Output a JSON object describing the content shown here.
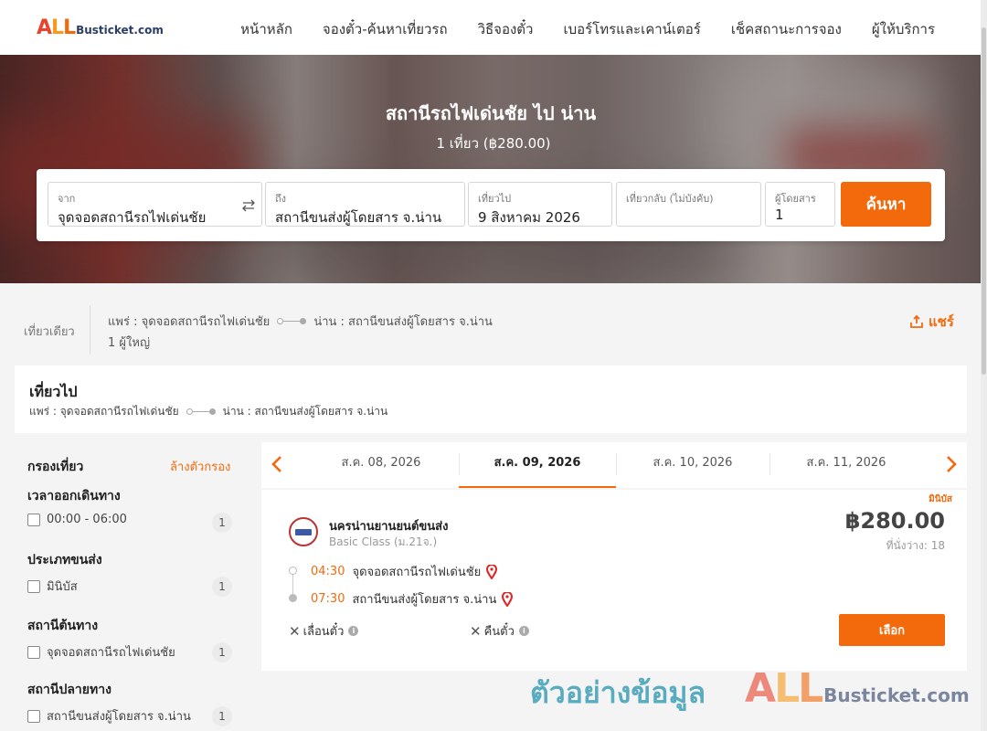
{
  "logo": {
    "all": "ALL",
    "rest": "Busticket.com",
    "colors": {
      "a": "#e8432c",
      "l1": "#f49a1c",
      "l2": "#f26a0c"
    }
  },
  "nav": [
    "หน้าหลัก",
    "จองตั๋ว-ค้นหาเที่ยวรถ",
    "วิธีจองตั๋ว",
    "เบอร์โทรและเคาน์เตอร์",
    "เช็คสถานะการจอง",
    "ผู้ให้บริการ"
  ],
  "hero": {
    "title": "สถานีรถไฟเด่นชัย ไป น่าน",
    "subtitle": "1 เที่ยว (฿280.00)"
  },
  "search": {
    "from_label": "จาก",
    "from_value": "จุดจอดสถานีรถไฟเด่นชัย",
    "to_label": "ถึง",
    "to_value": "สถานีขนส่งผู้โดยสาร จ.น่าน",
    "depart_label": "เที่ยวไป",
    "depart_value": "9 สิงหาคม 2026",
    "return_label": "เที่ยวกลับ (ไม่บังคับ)",
    "return_value": "",
    "pax_label": "ผู้โดยสาร",
    "pax_value": "1",
    "button": "ค้นหา"
  },
  "trip": {
    "type": "เที่ยวเดียว",
    "origin": "แพร่ : จุดจอดสถานีรถไฟเด่นชัย",
    "destination": "น่าน : สถานีขนส่งผู้โดยสาร จ.น่าน",
    "pax": "1 ผู้ใหญ่",
    "share": "แชร์"
  },
  "outbound": {
    "title": "เที่ยวไป",
    "origin": "แพร่ : จุดจอดสถานีรถไฟเด่นชัย",
    "destination": "น่าน : สถานีขนส่งผู้โดยสาร จ.น่าน"
  },
  "filter": {
    "title": "กรองเที่ยว",
    "clear": "ล้างตัวกรอง",
    "groups": [
      {
        "heading": "เวลาออกเดินทาง",
        "option": "00:00 - 06:00",
        "count": "1"
      },
      {
        "heading": "ประเภทขนส่ง",
        "option": "มินิบัส",
        "count": "1"
      },
      {
        "heading": "สถานีต้นทาง",
        "option": "จุดจอดสถานีรถไฟเด่นชัย",
        "count": "1"
      },
      {
        "heading": "สถานีปลายทาง",
        "option": "สถานีขนส่งผู้โดยสาร จ.น่าน",
        "count": "1"
      }
    ]
  },
  "dates": [
    "ส.ค. 08, 2026",
    "ส.ค. 09, 2026",
    "ส.ค. 10, 2026",
    "ส.ค. 11, 2026"
  ],
  "active_date": "ส.ค. 09, 2026",
  "result": {
    "vehicle": "มินิบัส",
    "operator": "นครน่านยานยนต์ขนส่ง",
    "class": "Basic Class (ม.21จ.)",
    "price": "฿280.00",
    "seats": "ที่นั่งว่าง: 18",
    "depart_time": "04:30",
    "depart_station": "จุดจอดสถานีรถไฟเด่นชัย",
    "arrive_time": "07:30",
    "arrive_station": "สถานีขนส่งผู้โดยสาร จ.น่าน",
    "policy_change": "เลื่อนตั๋ว",
    "policy_refund": "คืนตั๋ว",
    "select": "เลือก"
  },
  "watermark": {
    "text": "ตัวอย่างข้อมูล",
    "all": "ALL",
    "rest": "Busticket.com"
  },
  "colors": {
    "accent": "#f26a0c"
  }
}
